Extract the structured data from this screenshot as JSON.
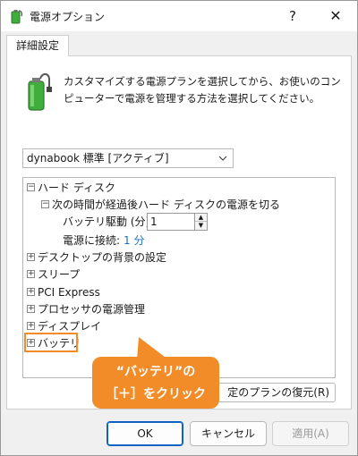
{
  "window": {
    "title": "電源オプション",
    "help_label": "?",
    "close_label": "✕"
  },
  "tab": {
    "label": "詳細設定"
  },
  "description": "カスタマイズする電源プランを選択してから、お使いのコンピューターで電源を管理する方法を選択してください。",
  "plan_select": {
    "value": "dynabook 標準 [アクティブ]"
  },
  "tree": {
    "hard_disk": "ハード ディスク",
    "turn_off_after": "次の時間が経過後ハード ディスクの電源を切る",
    "battery_label": "バッテリ駆動 (分):",
    "battery_value": "1",
    "ac_label": "電源に接続:",
    "ac_value": "1 分",
    "items": [
      "デスクトップの背景の設定",
      "スリープ",
      "PCI Express",
      "プロセッサの電源管理",
      "ディスプレイ",
      "バッテリ"
    ]
  },
  "callout": {
    "line1": "“バッテリ”の",
    "line2": "［＋］をクリック"
  },
  "restore_label": "定のプランの復元(R)",
  "buttons": {
    "ok": "OK",
    "cancel": "キャンセル",
    "apply": "適用(A)"
  },
  "colors": {
    "accent": "#f28c28",
    "link": "#1a6fc7",
    "battery_green": "#3fae3c"
  },
  "icons": {
    "app": "power-options-icon",
    "battery": "battery-plug-icon"
  }
}
